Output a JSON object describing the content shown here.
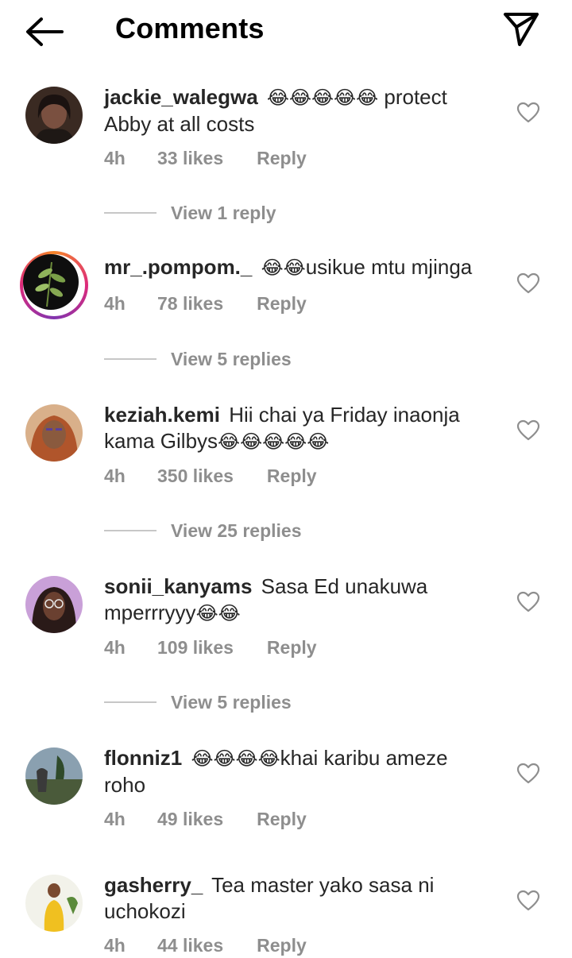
{
  "header": {
    "title": "Comments"
  },
  "comments": [
    {
      "username": "jackie_walegwa",
      "emoji_before": "😂😂😂😂😂",
      "text": " protect Abby at all costs",
      "time": "4h",
      "likes": "33 likes",
      "reply": "Reply",
      "view_replies": "View 1 reply"
    },
    {
      "username": "mr_.pompom._",
      "emoji_before": "😂😂",
      "text": "usikue mtu mjinga",
      "time": "4h",
      "likes": "78 likes",
      "reply": "Reply",
      "view_replies": "View 5 replies"
    },
    {
      "username": "keziah.kemi",
      "text": "Hii chai ya Friday inaonja kama Gilbys",
      "emoji_after": "😂😂😂😂😂",
      "time": "4h",
      "likes": "350 likes",
      "reply": "Reply",
      "view_replies": "View 25 replies"
    },
    {
      "username": "sonii_kanyams",
      "text": "Sasa Ed unakuwa mperrryyy",
      "emoji_after": "😂😂",
      "time": "4h",
      "likes": "109 likes",
      "reply": "Reply",
      "view_replies": "View 5 replies"
    },
    {
      "username": "flonniz1",
      "emoji_before": "😂😂😂😂",
      "text": "khai karibu ameze roho",
      "time": "4h",
      "likes": "49 likes",
      "reply": "Reply"
    },
    {
      "username": "gasherry_",
      "text": "Tea master yako sasa ni uchokozi",
      "time": "4h",
      "likes": "44 likes",
      "reply": "Reply"
    }
  ]
}
